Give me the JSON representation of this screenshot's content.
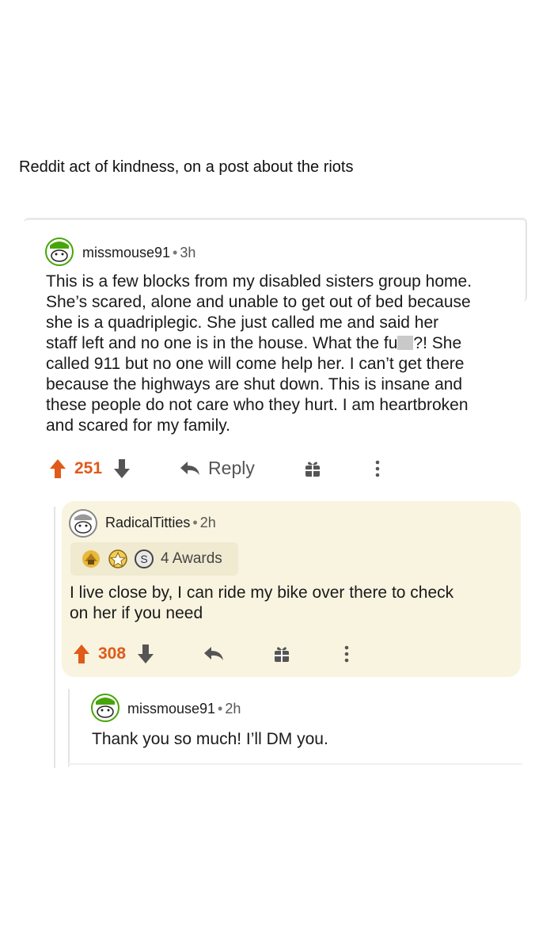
{
  "caption": "Reddit act of kindness, on a post about the riots",
  "comments": [
    {
      "username": "missmouse91",
      "separator": "•",
      "time": "3h",
      "text_lines": [
        "This is a few blocks from my disabled sisters group home.",
        "She’s scared, alone and unable to get out of bed because",
        "she is a quadriplegic. She just called me and said her",
        "staff left and no one is in the house. What the fu",
        "?! She",
        "called 911 but no one will come help her. I can’t get there",
        "because the highways are shut down. This is insane and",
        "these people do not care who they hurt. I am heartbroken",
        "and scared for my family."
      ],
      "votes": "251",
      "reply_label": "Reply"
    },
    {
      "username": "RadicalTitties",
      "separator": "•",
      "time": "2h",
      "awards_label": "4 Awards",
      "text_lines": [
        "I live close by, I can ride my bike over there to check",
        "on her if you need"
      ],
      "votes": "308"
    },
    {
      "username": "missmouse91",
      "separator": "•",
      "time": "2h",
      "text_lines": [
        "Thank you so much! I’ll DM you."
      ]
    }
  ],
  "colors": {
    "upvote": "#e05a1a",
    "reply_bg": "#f8f4df",
    "avatar_green": "#46a508"
  },
  "icons": [
    "avatar-icon",
    "upvote-icon",
    "downvote-icon",
    "reply-icon",
    "gift-icon",
    "more-icon",
    "award-icon"
  ]
}
